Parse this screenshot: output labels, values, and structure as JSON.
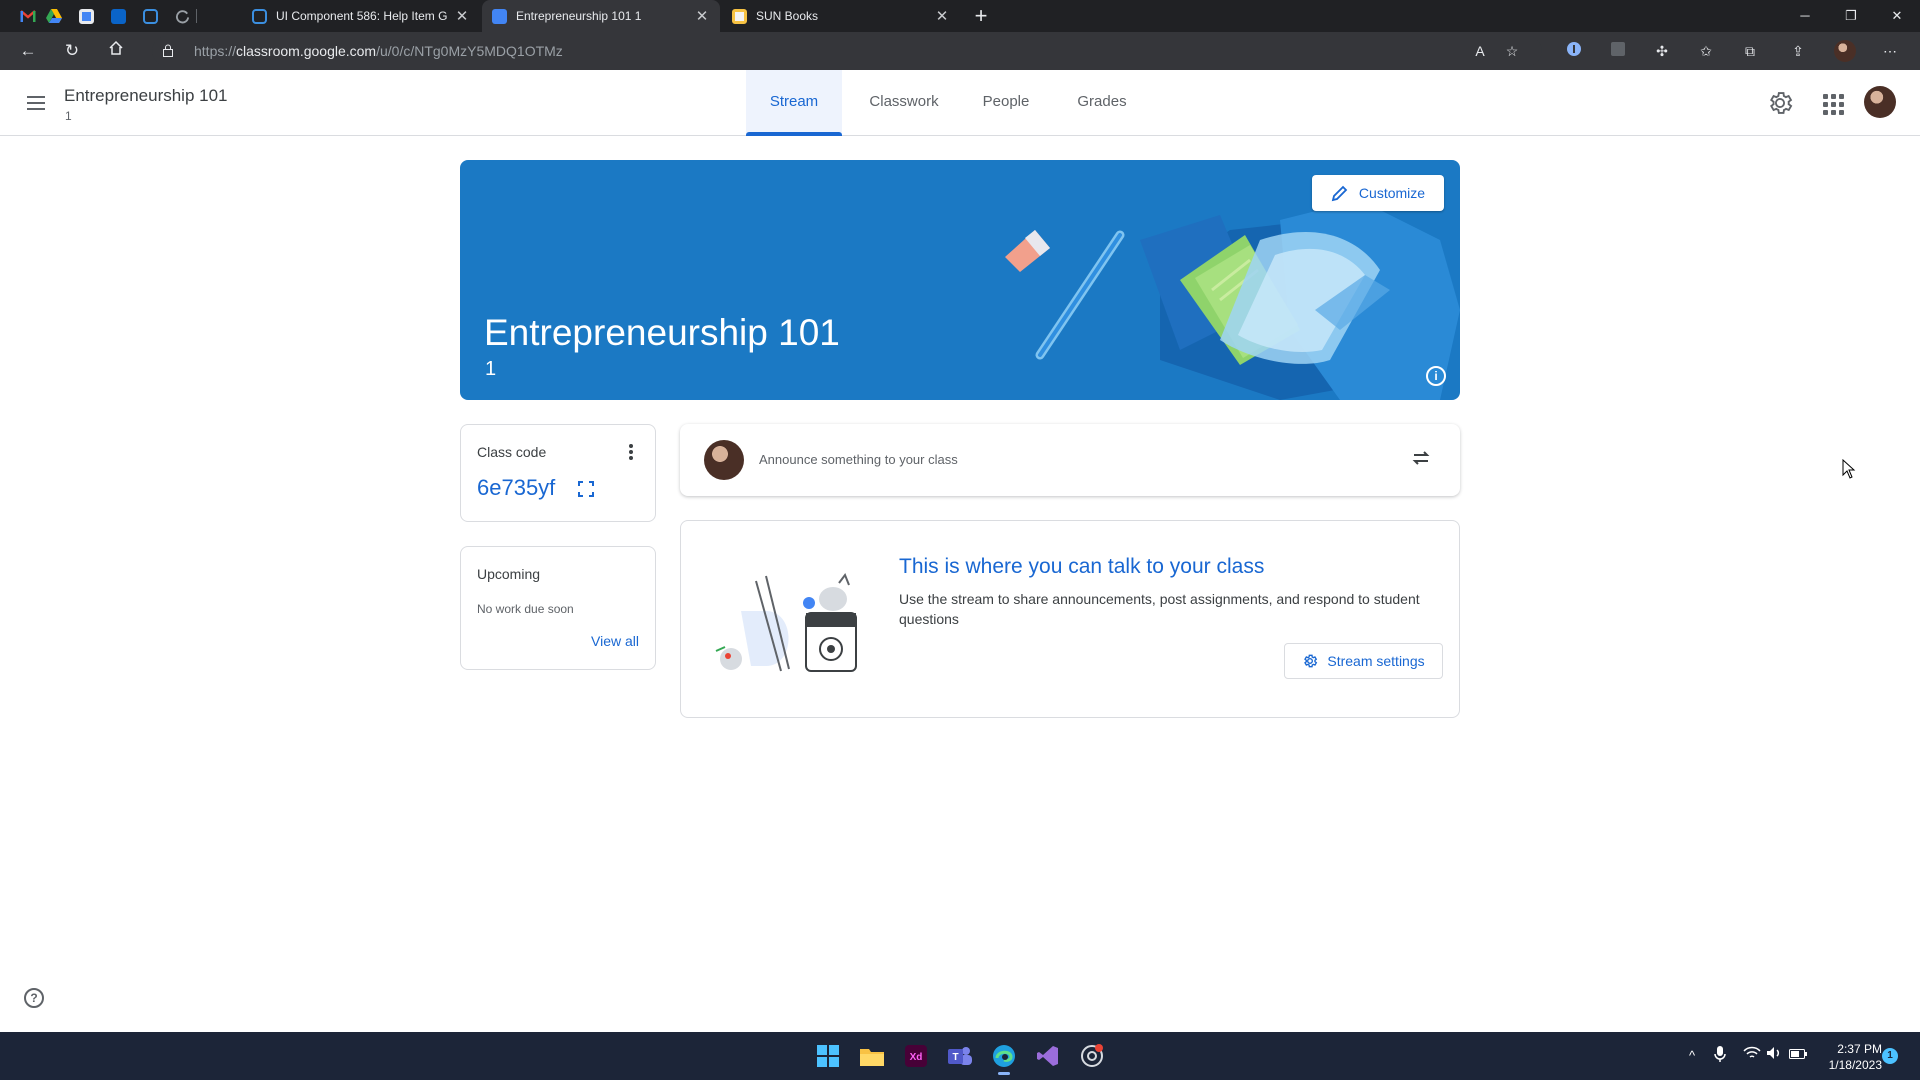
{
  "browser": {
    "tabs": [
      {
        "title": "UI Component 586: Help Item G",
        "active": false
      },
      {
        "title": "Entrepreneurship 101 1",
        "active": true
      },
      {
        "title": "SUN Books",
        "active": false
      }
    ],
    "url_prefix": "https://",
    "url_host": "classroom.google.com",
    "url_path": "/u/0/c/NTg0MzY5MDQ1OTMz",
    "window_controls": {
      "minimize": "─",
      "restore": "❐",
      "close": "✕"
    }
  },
  "app": {
    "class_name": "Entrepreneurship 101",
    "section": "1",
    "nav_tabs": [
      {
        "label": "Stream",
        "active": true
      },
      {
        "label": "Classwork",
        "active": false
      },
      {
        "label": "People",
        "active": false
      },
      {
        "label": "Grades",
        "active": false
      }
    ]
  },
  "banner": {
    "title": "Entrepreneurship 101",
    "section": "1",
    "customize_label": "Customize",
    "background_color": "#1b79c4"
  },
  "class_code": {
    "title": "Class code",
    "code": "6e735yf"
  },
  "upcoming": {
    "title": "Upcoming",
    "empty_text": "No work due soon",
    "view_all_label": "View all"
  },
  "announce": {
    "placeholder": "Announce something to your class"
  },
  "stream_intro": {
    "title": "This is where you can talk to your class",
    "description": "Use the stream to share announcements, post assignments, and respond to student questions",
    "settings_label": "Stream settings"
  },
  "taskbar": {
    "time": "2:37 PM",
    "date": "1/18/2023",
    "notification_count": "1"
  },
  "colors": {
    "accent": "#1967d2",
    "taskbar": "#1c2538",
    "chrome_dark": "#202124"
  }
}
